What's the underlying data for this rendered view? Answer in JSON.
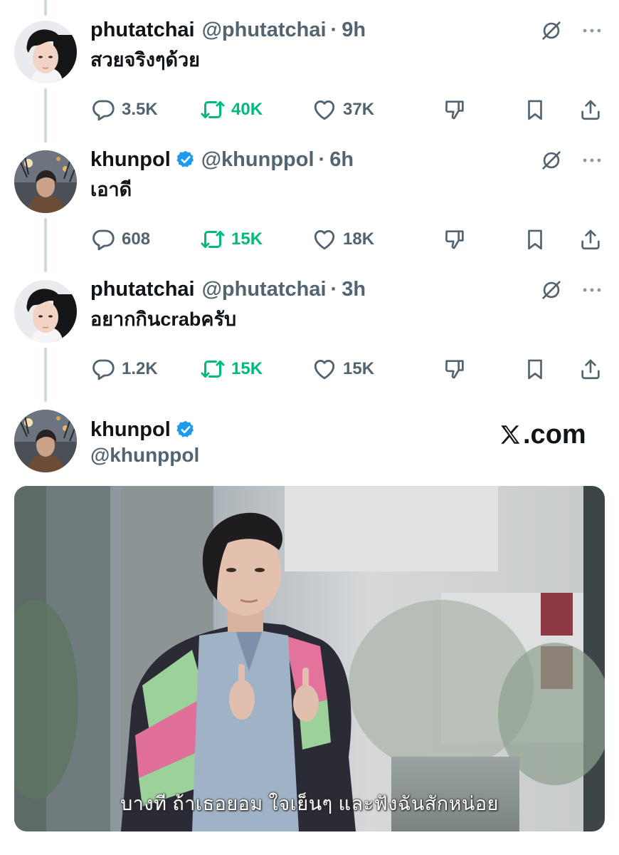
{
  "tweets": [
    {
      "name": "phutatchai",
      "verified": false,
      "handle": "@phutatchai",
      "dot": "·",
      "time": "9h",
      "text": "สวยจริงๆด้วย",
      "replies": "3.5K",
      "reposts": "40K",
      "likes": "37K"
    },
    {
      "name": "khunpol",
      "verified": true,
      "handle": "@khunppol",
      "dot": "·",
      "time": "6h",
      "text": "เอาดี",
      "replies": "608",
      "reposts": "15K",
      "likes": "18K"
    },
    {
      "name": "phutatchai",
      "verified": false,
      "handle": "@phutatchai",
      "dot": "·",
      "time": "3h",
      "text": "อยากกินcrabครับ",
      "replies": "1.2K",
      "reposts": "15K",
      "likes": "15K"
    }
  ],
  "final": {
    "name": "khunpol",
    "handle": "@khunppol",
    "watermark": ".com"
  },
  "media": {
    "subtitle": "บางที ถ้าเธอยอม ใจเย็นๆ และฟังฉันสักหน่อย"
  },
  "icons": [
    "grok-icon",
    "more-icon",
    "reply-icon",
    "repost-icon",
    "like-icon",
    "dislike-icon",
    "bookmark-icon",
    "share-icon",
    "verified-badge-icon",
    "x-logo-icon"
  ],
  "colors": {
    "text": "#0f1419",
    "secondary": "#536471",
    "repost": "#00ba7c",
    "verified": "#1d9bf0",
    "thread_line": "#cfd9de"
  }
}
